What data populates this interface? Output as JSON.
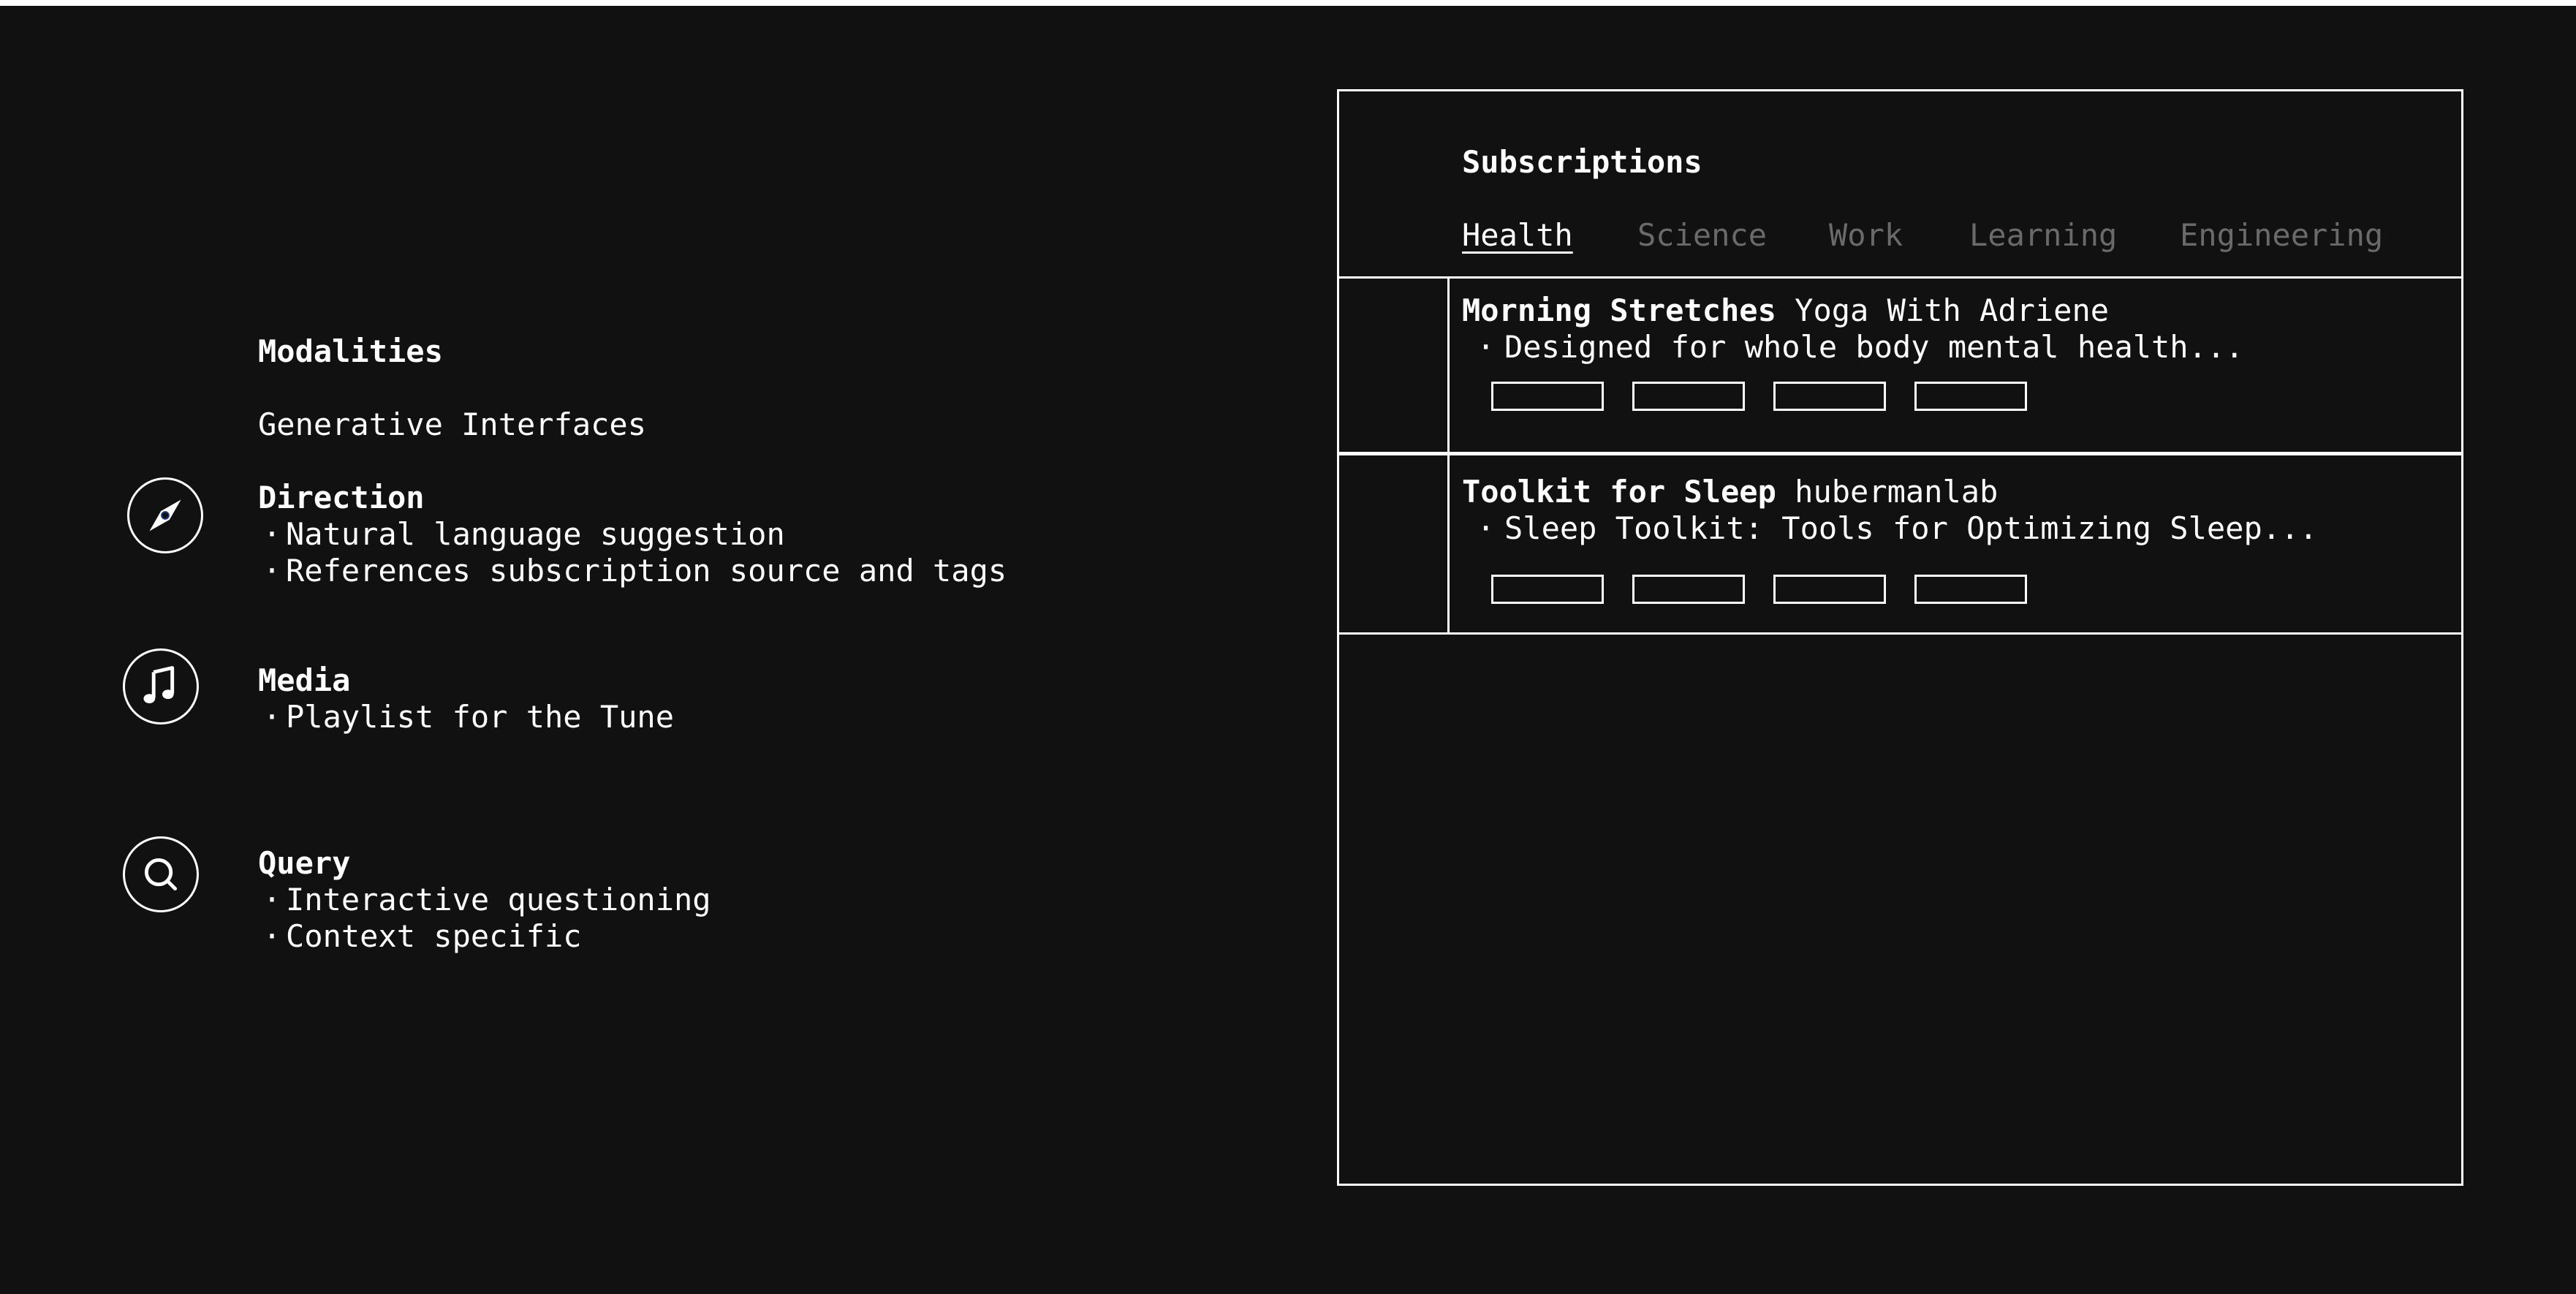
{
  "modalities": {
    "title": "Modalities",
    "subtitle": "Generative Interfaces",
    "sections": [
      {
        "icon": "compass-icon",
        "title": "Direction",
        "bullets": [
          "Natural language suggestion",
          "References subscription source and tags"
        ]
      },
      {
        "icon": "music-note-icon",
        "title": "Media",
        "bullets": [
          "Playlist for the Tune"
        ]
      },
      {
        "icon": "search-icon",
        "title": "Query",
        "bullets": [
          "Interactive questioning",
          "Context specific"
        ]
      }
    ]
  },
  "subscriptions": {
    "title": "Subscriptions",
    "tabs": [
      "Health",
      "Science",
      "Work",
      "Learning",
      "Engineering"
    ],
    "active_tab": "Health",
    "items": [
      {
        "title": "Morning Stretches",
        "source": "Yoga With Adriene",
        "description": "Designed for whole body mental health..."
      },
      {
        "title": "Toolkit for Sleep",
        "source": "hubermanlab",
        "description": "Sleep Toolkit: Tools for Optimizing Sleep..."
      }
    ]
  },
  "colors": {
    "background": "#111111",
    "foreground": "#ffffff",
    "inactive_tab": "#6a6a6a"
  },
  "bullet_char": "·"
}
